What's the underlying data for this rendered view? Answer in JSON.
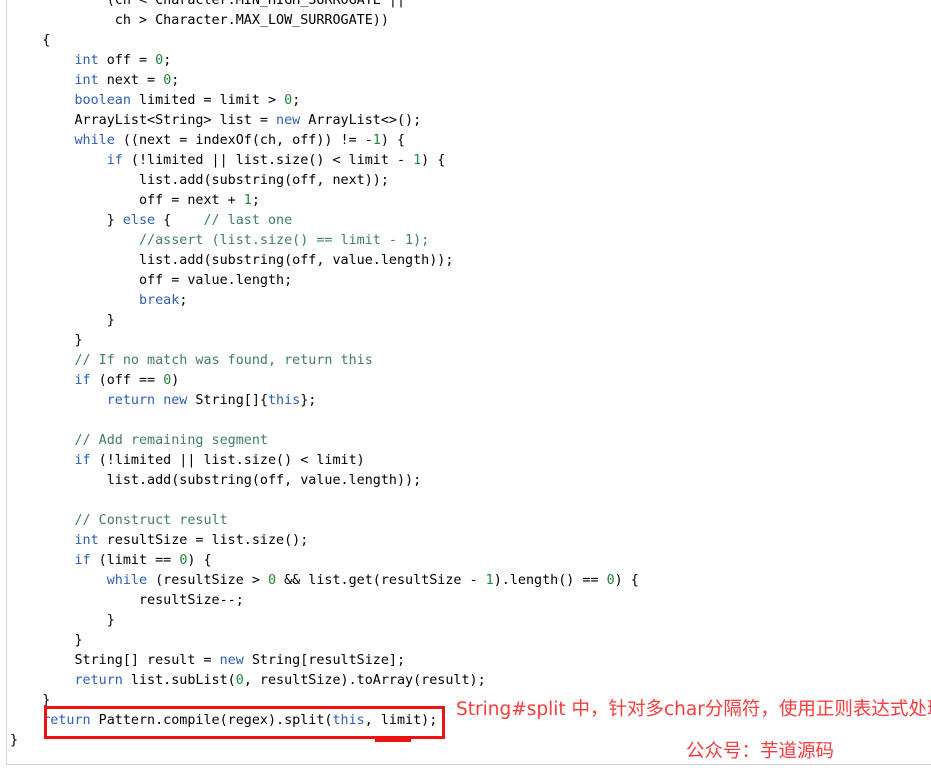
{
  "document": {
    "kind": "java-source-screenshot",
    "background": "#ffffff",
    "frame_color": "#d9d9d9"
  },
  "colors": {
    "keyword": "#2b5fb8",
    "number": "#1a8a3a",
    "comment": "#3f7f5f",
    "plain": "#000000",
    "annotation_red": "#fb3b3b",
    "box_red": "#ee1111"
  },
  "code": {
    "language": "java",
    "lines": [
      {
        "id": 1,
        "text": "            (ch < Character.MIN_HIGH_SURROGATE ||"
      },
      {
        "id": 2,
        "text": "             ch > Character.MAX_LOW_SURROGATE))"
      },
      {
        "id": 3,
        "text": "    {"
      },
      {
        "id": 4,
        "text": "        int off = 0;"
      },
      {
        "id": 5,
        "text": "        int next = 0;"
      },
      {
        "id": 6,
        "text": "        boolean limited = limit > 0;"
      },
      {
        "id": 7,
        "text": "        ArrayList<String> list = new ArrayList<>();"
      },
      {
        "id": 8,
        "text": "        while ((next = indexOf(ch, off)) != -1) {"
      },
      {
        "id": 9,
        "text": "            if (!limited || list.size() < limit - 1) {"
      },
      {
        "id": 10,
        "text": "                list.add(substring(off, next));"
      },
      {
        "id": 11,
        "text": "                off = next + 1;"
      },
      {
        "id": 12,
        "text": "            } else {    // last one"
      },
      {
        "id": 13,
        "text": "                //assert (list.size() == limit - 1);"
      },
      {
        "id": 14,
        "text": "                list.add(substring(off, value.length));"
      },
      {
        "id": 15,
        "text": "                off = value.length;"
      },
      {
        "id": 16,
        "text": "                break;"
      },
      {
        "id": 17,
        "text": "            }"
      },
      {
        "id": 18,
        "text": "        }"
      },
      {
        "id": 19,
        "text": "        // If no match was found, return this"
      },
      {
        "id": 20,
        "text": "        if (off == 0)"
      },
      {
        "id": 21,
        "text": "            return new String[]{this};"
      },
      {
        "id": 22,
        "text": ""
      },
      {
        "id": 23,
        "text": "        // Add remaining segment"
      },
      {
        "id": 24,
        "text": "        if (!limited || list.size() < limit)"
      },
      {
        "id": 25,
        "text": "            list.add(substring(off, value.length));"
      },
      {
        "id": 26,
        "text": ""
      },
      {
        "id": 27,
        "text": "        // Construct result"
      },
      {
        "id": 28,
        "text": "        int resultSize = list.size();"
      },
      {
        "id": 29,
        "text": "        if (limit == 0) {"
      },
      {
        "id": 30,
        "text": "            while (resultSize > 0 && list.get(resultSize - 1).length() == 0) {"
      },
      {
        "id": 31,
        "text": "                resultSize--;"
      },
      {
        "id": 32,
        "text": "            }"
      },
      {
        "id": 33,
        "text": "        }"
      },
      {
        "id": 34,
        "text": "        String[] result = new String[resultSize];"
      },
      {
        "id": 35,
        "text": "        return list.subList(0, resultSize).toArray(result);"
      },
      {
        "id": 36,
        "text": "    }"
      },
      {
        "id": 37,
        "text": "    return Pattern.compile(regex).split(this, limit);"
      },
      {
        "id": 38,
        "text": "}"
      }
    ]
  },
  "annotations": {
    "highlight_box_label": "return Pattern.compile(regex).split(this, limit);",
    "note": "String#split 中，针对多char分隔符，使用正则表达式处理",
    "signature": "公众号：芋道源码"
  }
}
